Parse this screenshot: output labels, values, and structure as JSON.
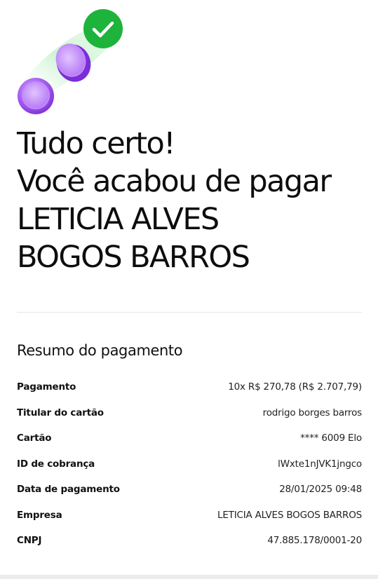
{
  "hero": {
    "icon": "coins-with-check-icon",
    "colors": {
      "check_badge": "#1eb33b",
      "coin": "#a45af0",
      "trail": "#c9f2cf"
    }
  },
  "headline": {
    "line1": "Tudo certo!",
    "line2": "Você acabou de pagar",
    "line3": "LETICIA ALVES",
    "line4": "BOGOS BARROS"
  },
  "summary": {
    "title": "Resumo do pagamento",
    "rows": [
      {
        "label": "Pagamento",
        "value": "10x R$ 270,78 (R$ 2.707,79)"
      },
      {
        "label": "Titular do cartão",
        "value": "rodrigo borges barros"
      },
      {
        "label": "Cartão",
        "value": "**** 6009 Elo"
      },
      {
        "label": "ID de cobrança",
        "value": "lWxte1nJVK1jngco"
      },
      {
        "label": "Data de pagamento",
        "value": "28/01/2025 09:48"
      },
      {
        "label": "Empresa",
        "value": "LETICIA ALVES BOGOS BARROS"
      },
      {
        "label": "CNPJ",
        "value": "47.885.178/0001-20"
      }
    ]
  }
}
